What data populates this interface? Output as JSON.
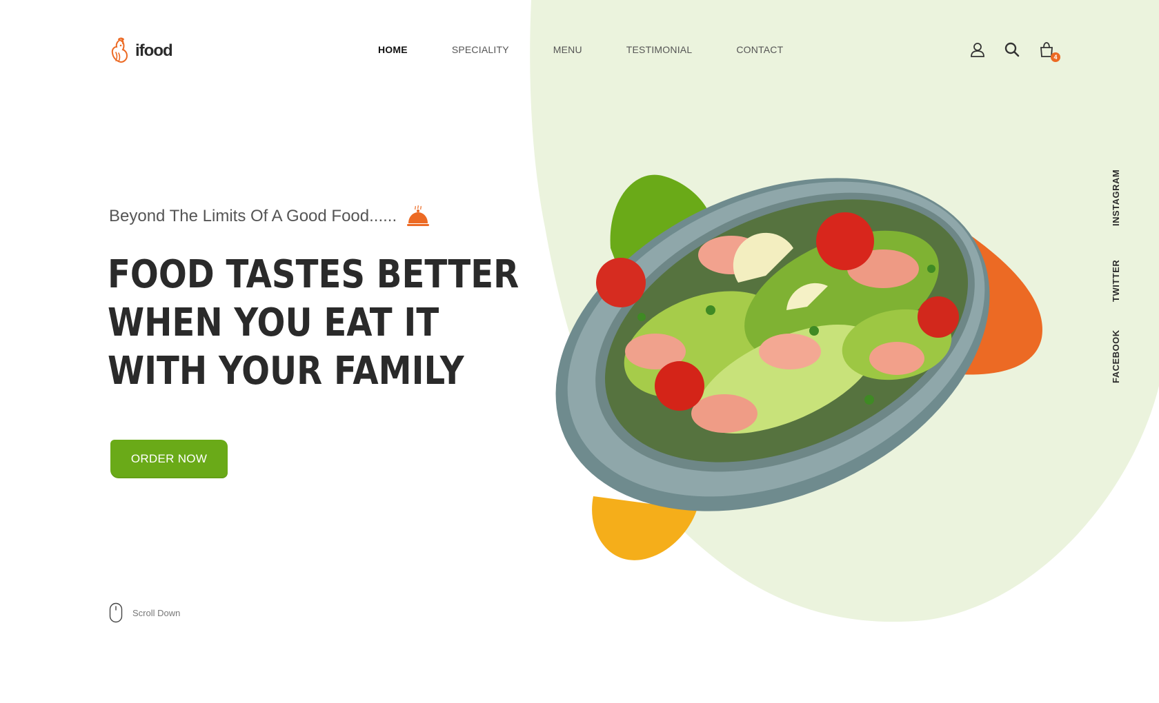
{
  "brand": {
    "name": "ifood",
    "logo_icon": "rooster-icon"
  },
  "nav": {
    "items": [
      {
        "label": "HOME",
        "active": true
      },
      {
        "label": "SPECIALITY",
        "active": false
      },
      {
        "label": "MENU",
        "active": false
      },
      {
        "label": "TESTIMONIAL",
        "active": false
      },
      {
        "label": "CONTACT",
        "active": false
      }
    ]
  },
  "header_icons": {
    "user": "user-icon",
    "search": "search-icon",
    "cart": "cart-icon",
    "cart_count": "4"
  },
  "hero": {
    "tagline": "Beyond The Limits Of A Good Food......",
    "tagline_icon": "cloche-icon",
    "headline": [
      "FOOD TASTES BETTER",
      "WHEN YOU EAT IT",
      "WITH YOUR FAMILY"
    ],
    "cta_label": "ORDER NOW",
    "scroll_label": "Scroll Down"
  },
  "social": [
    "INSTAGRAM",
    "TWITTER",
    "FACEBOOK"
  ],
  "colors": {
    "accent_green": "#6aaa18",
    "accent_orange": "#ec6a24",
    "accent_yellow": "#f5ae1a",
    "background_blob": "#ebf3dd",
    "text_dark": "#2a2a2a"
  }
}
